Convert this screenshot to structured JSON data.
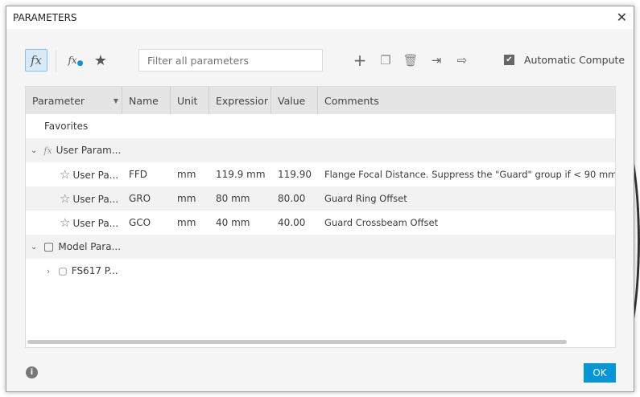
{
  "title": "PARAMETERS",
  "toolbar": {
    "fx": "fx",
    "fx_user": "fx",
    "filter_placeholder": "Filter all parameters",
    "auto_compute": "Automatic Compute",
    "auto_checked": true
  },
  "columns": [
    "Parameter",
    "Name",
    "Unit",
    "Expressior",
    "Value",
    "Comments"
  ],
  "favorites": "Favorites",
  "user_group": "User Param...",
  "rows": [
    {
      "param": "User Pa...",
      "name": "FFD",
      "unit": "mm",
      "expr": "119.9 mm",
      "value": "119.90",
      "comment": "Flange Focal Distance. Suppress the \"Guard\" group if < 90 mm"
    },
    {
      "param": "User Pa...",
      "name": "GRO",
      "unit": "mm",
      "expr": "80 mm",
      "value": "80.00",
      "comment": "Guard Ring Offset"
    },
    {
      "param": "User Pa...",
      "name": "GCO",
      "unit": "mm",
      "expr": "40 mm",
      "value": "40.00",
      "comment": "Guard Crossbeam Offset"
    }
  ],
  "model_group": "Model Para...",
  "model_child": "FS617 P...",
  "ok": "OK"
}
